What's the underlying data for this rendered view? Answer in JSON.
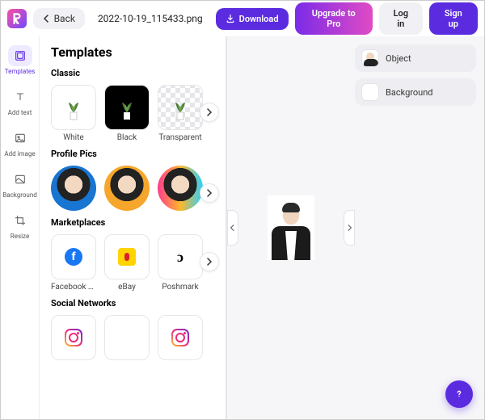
{
  "topbar": {
    "back_label": "Back",
    "filename": "2022-10-19_115433.png",
    "download_label": "Download",
    "upgrade_label": "Upgrade to Pro",
    "login_label": "Log in",
    "signup_label": "Sign up"
  },
  "rail": {
    "templates": "Templates",
    "add_text": "Add text",
    "add_image": "Add image",
    "background": "Background",
    "resize": "Resize"
  },
  "panel": {
    "title": "Templates",
    "sections": {
      "classic": {
        "title": "Classic",
        "items": [
          "White",
          "Black",
          "Transparent"
        ]
      },
      "profile": {
        "title": "Profile Pics"
      },
      "marketplaces": {
        "title": "Marketplaces",
        "items": [
          "Facebook Ma...",
          "eBay",
          "Poshmark"
        ]
      },
      "social": {
        "title": "Social Networks"
      }
    }
  },
  "sidepanel": {
    "object_label": "Object",
    "background_label": "Background"
  }
}
